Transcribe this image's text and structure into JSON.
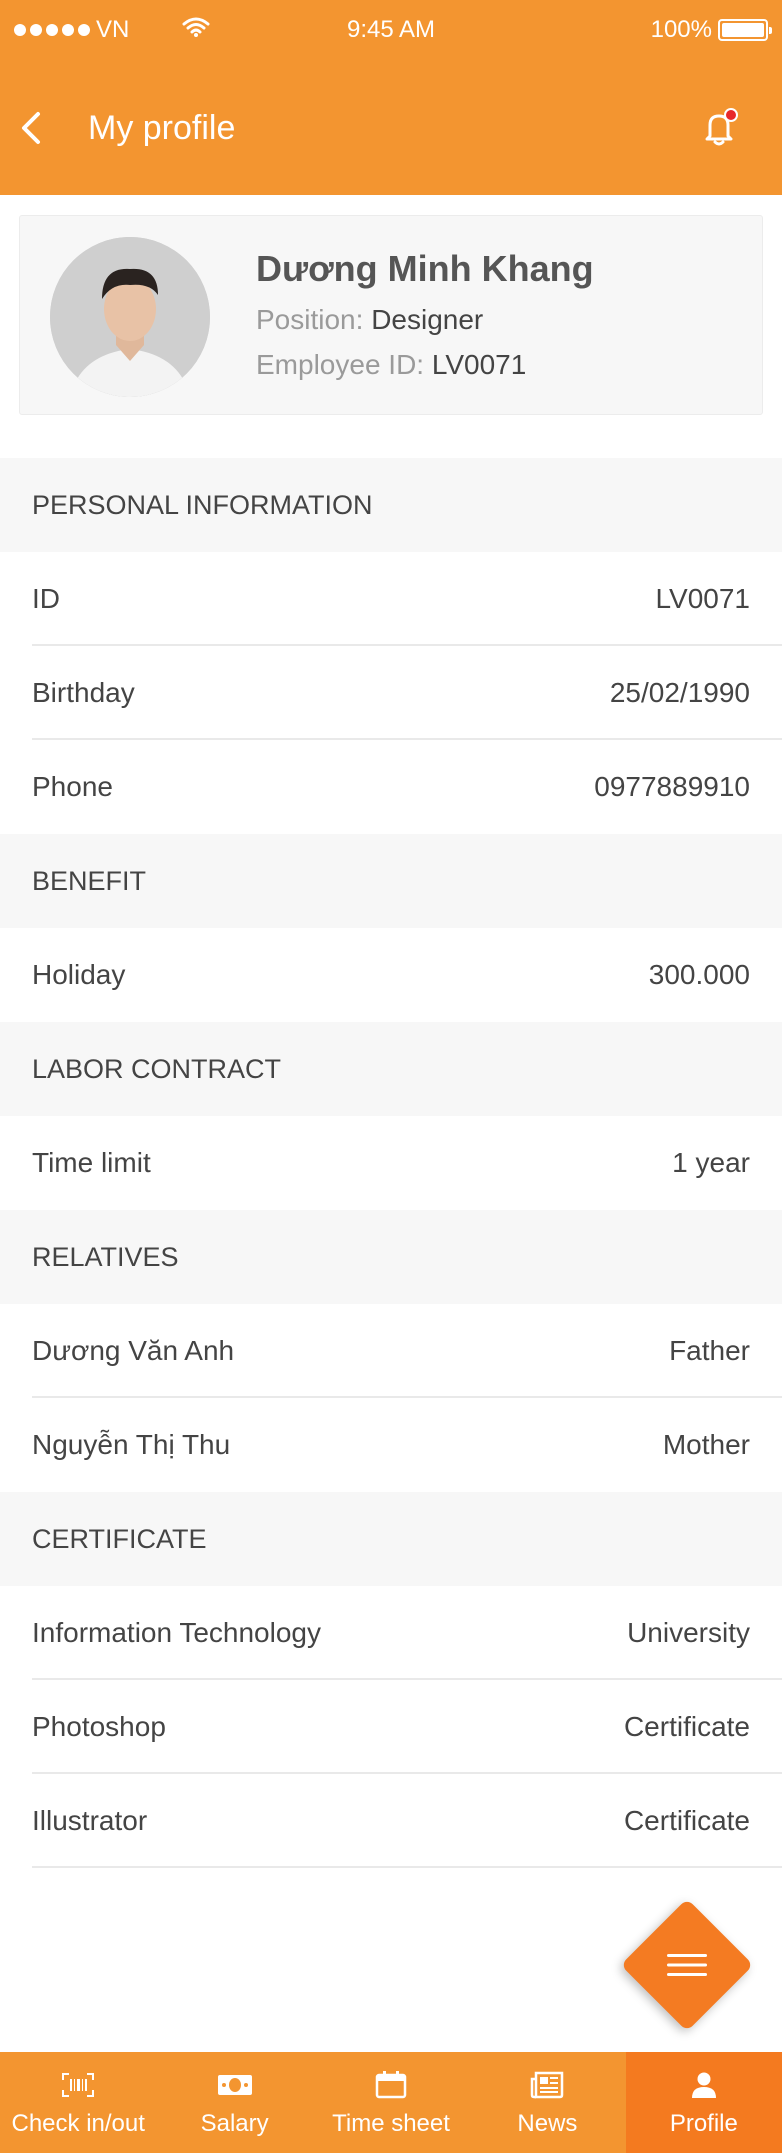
{
  "status_bar": {
    "carrier": "VN",
    "time": "9:45 AM",
    "battery": "100%"
  },
  "header": {
    "title": "My profile"
  },
  "profile": {
    "name": "Dương Minh Khang",
    "position_label": "Position:",
    "position_value": "Designer",
    "employee_id_label": "Employee ID:",
    "employee_id_value": "LV0071"
  },
  "sections": [
    {
      "title": "PERSONAL INFORMATION",
      "rows": [
        {
          "label": "ID",
          "value": "LV0071"
        },
        {
          "label": "Birthday",
          "value": "25/02/1990"
        },
        {
          "label": "Phone",
          "value": "0977889910"
        }
      ]
    },
    {
      "title": "BENEFIT",
      "rows": [
        {
          "label": "Holiday",
          "value": "300.000"
        }
      ]
    },
    {
      "title": "LABOR CONTRACT",
      "rows": [
        {
          "label": "Time limit",
          "value": "1 year"
        }
      ]
    },
    {
      "title": "RELATIVES",
      "rows": [
        {
          "label": "Dương Văn Anh",
          "value": "Father"
        },
        {
          "label": "Nguyễn Thị Thu",
          "value": "Mother"
        }
      ]
    },
    {
      "title": "CERTIFICATE",
      "rows": [
        {
          "label": "Information Technology",
          "value": "University"
        },
        {
          "label": "Photoshop",
          "value": "Certificate"
        },
        {
          "label": "Illustrator",
          "value": "Certificate"
        }
      ]
    }
  ],
  "tabbar": {
    "items": [
      {
        "label": "Check in/out",
        "icon": "barcode-icon"
      },
      {
        "label": "Salary",
        "icon": "money-icon"
      },
      {
        "label": "Time sheet",
        "icon": "calendar-icon"
      },
      {
        "label": "News",
        "icon": "newspaper-icon"
      },
      {
        "label": "Profile",
        "icon": "user-icon",
        "active": true
      }
    ]
  },
  "colors": {
    "primary": "#f39530",
    "accent": "#f47a1f",
    "badge": "#e8282a"
  }
}
